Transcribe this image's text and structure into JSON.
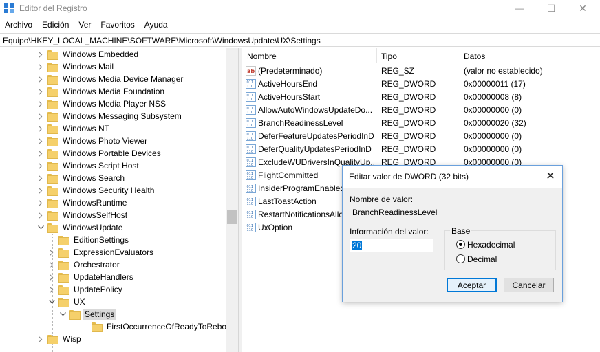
{
  "window": {
    "title": "Editor del Registro",
    "minimize_glyph": "—",
    "maximize_glyph": "☐",
    "close_glyph": "✕",
    "icon": "registry-editor-icon"
  },
  "menu": [
    "Archivo",
    "Edición",
    "Ver",
    "Favoritos",
    "Ayuda"
  ],
  "address": "Equipo\\HKEY_LOCAL_MACHINE\\SOFTWARE\\Microsoft\\WindowsUpdate\\UX\\Settings",
  "tree": {
    "items": [
      {
        "label": "Windows Embedded",
        "expanded": false
      },
      {
        "label": "Windows Mail",
        "expanded": false
      },
      {
        "label": "Windows Media Device Manager",
        "expanded": false
      },
      {
        "label": "Windows Media Foundation",
        "expanded": false
      },
      {
        "label": "Windows Media Player NSS",
        "expanded": false
      },
      {
        "label": "Windows Messaging Subsystem",
        "expanded": false
      },
      {
        "label": "Windows NT",
        "expanded": false
      },
      {
        "label": "Windows Photo Viewer",
        "expanded": false
      },
      {
        "label": "Windows Portable Devices",
        "expanded": false
      },
      {
        "label": "Windows Script Host",
        "expanded": false
      },
      {
        "label": "Windows Search",
        "expanded": false
      },
      {
        "label": "Windows Security Health",
        "expanded": false
      },
      {
        "label": "WindowsRuntime",
        "expanded": false
      },
      {
        "label": "WindowsSelfHost",
        "expanded": false
      },
      {
        "label": "WindowsUpdate",
        "expanded": true
      },
      {
        "label": "EditionSettings",
        "expanded": false
      },
      {
        "label": "ExpressionEvaluators",
        "expanded": false
      },
      {
        "label": "Orchestrator",
        "expanded": false
      },
      {
        "label": "UpdateHandlers",
        "expanded": false
      },
      {
        "label": "UpdatePolicy",
        "expanded": false
      },
      {
        "label": "UX",
        "expanded": true
      },
      {
        "label": "Settings",
        "expanded": true,
        "selected": true
      },
      {
        "label": "FirstOccurrenceOfReadyToReboot",
        "expanded": false
      },
      {
        "label": "Wisp",
        "expanded": false
      }
    ]
  },
  "list": {
    "columns": [
      "Nombre",
      "Tipo",
      "Datos"
    ],
    "rows": [
      {
        "name": "(Predeterminado)",
        "type": "REG_SZ",
        "data": "(valor no establecido)",
        "icon": "string-value-icon"
      },
      {
        "name": "ActiveHoursEnd",
        "type": "REG_DWORD",
        "data": "0x00000011 (17)",
        "icon": "binary-value-icon"
      },
      {
        "name": "ActiveHoursStart",
        "type": "REG_DWORD",
        "data": "0x00000008 (8)",
        "icon": "binary-value-icon"
      },
      {
        "name": "AllowAutoWindowsUpdateDo...",
        "type": "REG_DWORD",
        "data": "0x00000000 (0)",
        "icon": "binary-value-icon"
      },
      {
        "name": "BranchReadinessLevel",
        "type": "REG_DWORD",
        "data": "0x00000020 (32)",
        "icon": "binary-value-icon"
      },
      {
        "name": "DeferFeatureUpdatesPeriodInD",
        "type": "REG_DWORD",
        "data": "0x00000000 (0)",
        "icon": "binary-value-icon"
      },
      {
        "name": "DeferQualityUpdatesPeriodInD",
        "type": "REG_DWORD",
        "data": "0x00000000 (0)",
        "icon": "binary-value-icon"
      },
      {
        "name": "ExcludeWUDriversInQualityUp...",
        "type": "REG_DWORD",
        "data": "0x00000000 (0)",
        "icon": "binary-value-icon"
      },
      {
        "name": "FlightCommitted",
        "type": "",
        "data": "",
        "icon": "binary-value-icon"
      },
      {
        "name": "InsiderProgramEnabled",
        "type": "",
        "data": "",
        "icon": "binary-value-icon"
      },
      {
        "name": "LastToastAction",
        "type": "",
        "data": "",
        "icon": "binary-value-icon"
      },
      {
        "name": "RestartNotificationsAllo",
        "type": "",
        "data": "",
        "icon": "binary-value-icon"
      },
      {
        "name": "UxOption",
        "type": "",
        "data": "",
        "icon": "binary-value-icon"
      }
    ]
  },
  "dialog": {
    "title": "Editar valor de DWORD (32 bits)",
    "close_glyph": "✕",
    "name_label": "Nombre de valor:",
    "name_value": "BranchReadinessLevel",
    "data_label": "Información del valor:",
    "data_value": "20",
    "base_label": "Base",
    "base_hex": "Hexadecimal",
    "base_dec": "Decimal",
    "base_selected": "Hexadecimal",
    "ok": "Aceptar",
    "cancel": "Cancelar",
    "accent": "#0078d7"
  }
}
